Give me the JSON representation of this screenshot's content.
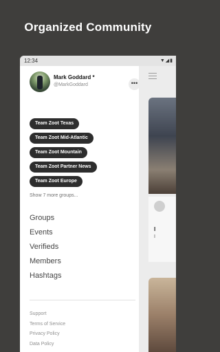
{
  "promo": {
    "title": "Organized Community"
  },
  "statusbar": {
    "time": "12:34",
    "icons": "▼◢▮"
  },
  "profile": {
    "name": "Mark Goddard *",
    "handle": "@MarkGoddard",
    "more": "•••"
  },
  "groups": [
    {
      "label": "Team Zoot Texas"
    },
    {
      "label": "Team Zoot Mid-Atlantic"
    },
    {
      "label": "Team Zoot Mountain"
    },
    {
      "label": "Team Zoot Partner News"
    },
    {
      "label": "Team Zoot Europe"
    }
  ],
  "show_more": "Show 7 more groups...",
  "nav": [
    {
      "label": "Groups"
    },
    {
      "label": "Events"
    },
    {
      "label": "Verifieds"
    },
    {
      "label": "Members"
    },
    {
      "label": "Hashtags"
    }
  ],
  "footer": [
    {
      "label": "Support"
    },
    {
      "label": "Terms of Service"
    },
    {
      "label": "Privacy Policy"
    },
    {
      "label": "Data Policy"
    }
  ],
  "background_card": {
    "title_fragment": "I",
    "sub_fragment": "I"
  },
  "colors": {
    "chip_bg": "#2d2d2d",
    "page_bg": "#3f3e3c"
  }
}
